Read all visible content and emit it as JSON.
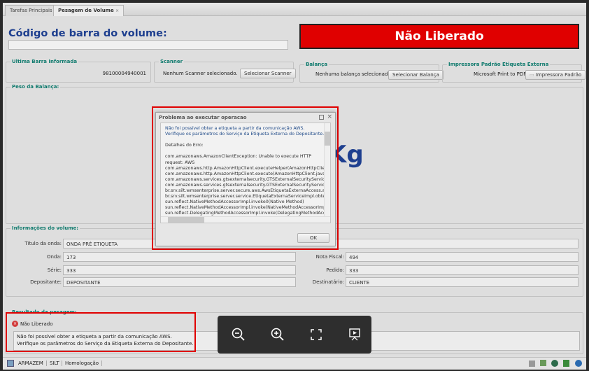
{
  "tabs": [
    {
      "label": "Tarefas Principais"
    },
    {
      "label": "Pesagem de Volume",
      "close": "×"
    }
  ],
  "barcode": {
    "title": "Código de barra do volume:",
    "value": ""
  },
  "status_banner": {
    "text": "Não Liberado",
    "color": "#e00000"
  },
  "ultima": {
    "legend": "Ultima Barra Informada",
    "value": "98100004940001"
  },
  "scanner": {
    "legend": "Scanner",
    "status": "Nenhum Scanner selecionado.",
    "button": "Selecionar Scanner"
  },
  "balanca": {
    "legend": "Balança",
    "status": "Nenhuma balança selecionada.",
    "button": "Selecionar Balança"
  },
  "impressora": {
    "legend": "Impressora Padrão Etiqueta Externa",
    "value": "Microsoft Print to PDF",
    "button": "Impressora Padrão"
  },
  "peso": {
    "legend": "Peso da Balança:",
    "unit": "Kg"
  },
  "dialog": {
    "title": "Problema ao executar operacao",
    "lines": [
      "Não foi possível obter a etiqueta a partir da comunicação AWS.",
      "Verifique os parâmetros do Serviço da Etiqueta Externa do Depositante.",
      "",
      "Detalhes do Erro:",
      "",
      "com.amazonaws.AmazonClientException: Unable to execute HTTP",
      "request: AWS",
      "com.amazonaws.http.AmazonHttpClient.executeHelper(AmazonHttpClient",
      "com.amazonaws.http.AmazonHttpClient.execute(AmazonHttpClient.java:",
      "com.amazonaws.services.gtsexternalsecurity.GTSExternalSecurityService",
      "com.amazonaws.services.gtsexternalsecurity.GTSExternalSecurityService",
      "br.srv.silt.wmsenterprise.server.secure.aws.AwsEtiquetaExternaAccess.a",
      "br.srv.silt.wmsenterprise.server.service.EtiquetaExternaServiceImpl.obter",
      "sun.reflect.NativeMethodAccessorImpl.invoke0(Native Method)",
      "sun.reflect.NativeMethodAccessorImpl.invoke(NativeMethodAccessorImpl.",
      "sun.reflect.DelegatingMethodAccessorImpl.invoke(DelegatingMethodAcces"
    ],
    "ok": "OK"
  },
  "info": {
    "legend": "Informações do volume:",
    "fields": {
      "titulo": {
        "label": "Título da onda:",
        "value": "ONDA PRÉ ETIQUETA"
      },
      "onda": {
        "label": "Onda:",
        "value": "173"
      },
      "serie": {
        "label": "Série:",
        "value": "333"
      },
      "depositante": {
        "label": "Depositante:",
        "value": "DEPOSITANTE"
      },
      "nota": {
        "label": "Nota Fiscal:",
        "value": "494"
      },
      "pedido": {
        "label": "Pedido:",
        "value": "333"
      },
      "destinatario": {
        "label": "Destinatário:",
        "value": "CLIENTE"
      }
    }
  },
  "resultado": {
    "legend": "Resultado da pesagem:",
    "status": "Não Liberado",
    "message_lines": [
      "Não foi possível obter a etiqueta a partir da comunicação AWS.",
      "Verifique os parâmetros do Serviço da Etiqueta Externa do Depositante."
    ]
  },
  "statusbar": {
    "items": [
      "ARMAZEM",
      "SILT",
      "Homologação"
    ]
  },
  "viewer": {
    "icons": [
      "zoom-out-icon",
      "zoom-in-icon",
      "fullscreen-icon",
      "slideshow-icon"
    ]
  }
}
